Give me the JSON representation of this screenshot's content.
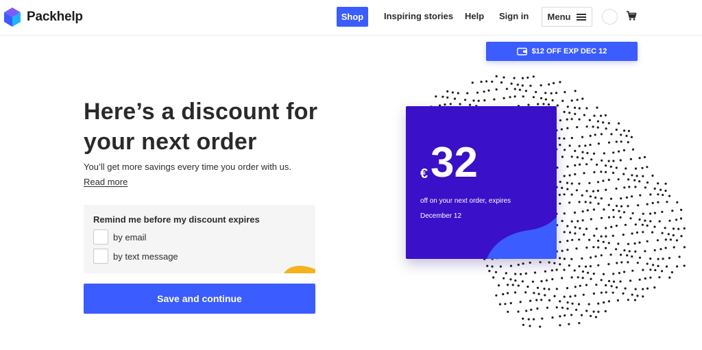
{
  "header": {
    "brand": "Packhelp",
    "nav": {
      "shop": "Shop",
      "inspiring": "Inspiring stories",
      "help": "Help",
      "signin": "Sign in",
      "menu": "Menu"
    },
    "icons": [
      "packhelp-logo-icon",
      "hamburger-icon",
      "avatar-icon",
      "cart-icon"
    ]
  },
  "promo": {
    "label": "$12 OFF EXP DEC 12",
    "icon": "wallet-icon"
  },
  "main": {
    "headline": "Here’s a discount for your next order",
    "subtitle": "You’ll get more savings every time you order with us.",
    "read_more": "Read more",
    "remind": {
      "title": "Remind me before my discount expires",
      "options": [
        {
          "label": "by email",
          "checked": false
        },
        {
          "label": "by text message",
          "checked": false
        }
      ]
    },
    "cta": "Save and continue"
  },
  "card": {
    "currency": "€",
    "amount": "32",
    "description": "off on your next order, expires",
    "date": "December 12"
  },
  "colors": {
    "accent": "#3b5cff",
    "card": "#3a10c8",
    "blob": "#f5b21f"
  }
}
